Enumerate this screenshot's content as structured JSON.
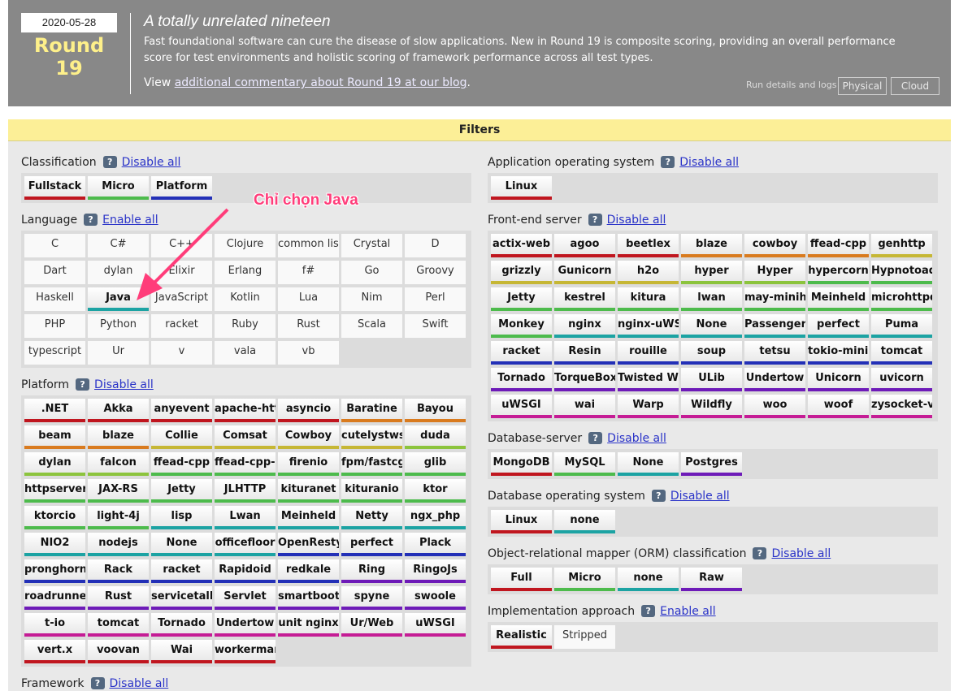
{
  "header": {
    "date": "2020-05-28",
    "round": "Round 19",
    "title": "A totally unrelated nineteen",
    "description": "Fast foundational software can cure the disease of slow applications. New in Round 19 is composite scoring, providing an overall performance score for test environments and holistic scoring of framework performance across all test types.",
    "view_prefix": "View ",
    "view_link": "additional commentary about Round 19 at our blog",
    "view_suffix": ".",
    "run_details": "Run details and logs",
    "physical": "Physical",
    "cloud": "Cloud"
  },
  "filters_title": "Filters",
  "help_glyph": "?",
  "annotation": "Chỉ chọn Java",
  "colors": {
    "red": "#c0161f",
    "green": "#4dbb4c",
    "blue": "#2330b7",
    "teal": "#1ca3a3",
    "orange": "#d97b1f",
    "yellow": "#c6b735",
    "lime": "#8cc43d",
    "purple": "#6e1bb8",
    "magenta": "#c51c95",
    "navy": "#1c3ea6",
    "arrow": "#ff3d7a"
  },
  "sections": [
    {
      "title": "Classification",
      "action": "Disable all",
      "cols": 3,
      "items": [
        [
          "Fullstack",
          "red",
          1
        ],
        [
          "Micro",
          "green",
          1
        ],
        [
          "Platform",
          "blue",
          1
        ]
      ]
    },
    {
      "title": "Language",
      "action": "Enable all",
      "cols": 7,
      "items": [
        [
          "C",
          "",
          0
        ],
        [
          "C#",
          "",
          0
        ],
        [
          "C++",
          "",
          0
        ],
        [
          "Clojure",
          "",
          0
        ],
        [
          "common lisp",
          "",
          0
        ],
        [
          "Crystal",
          "",
          0
        ],
        [
          "D",
          "",
          0
        ],
        [
          "Dart",
          "",
          0
        ],
        [
          "dylan",
          "",
          0
        ],
        [
          "Elixir",
          "",
          0
        ],
        [
          "Erlang",
          "",
          0
        ],
        [
          "f#",
          "",
          0
        ],
        [
          "Go",
          "",
          0
        ],
        [
          "Groovy",
          "",
          0
        ],
        [
          "Haskell",
          "",
          0
        ],
        [
          "Java",
          "teal",
          1
        ],
        [
          "JavaScript",
          "",
          0
        ],
        [
          "Kotlin",
          "",
          0
        ],
        [
          "Lua",
          "",
          0
        ],
        [
          "Nim",
          "",
          0
        ],
        [
          "Perl",
          "",
          0
        ],
        [
          "PHP",
          "",
          0
        ],
        [
          "Python",
          "",
          0
        ],
        [
          "racket",
          "",
          0
        ],
        [
          "Ruby",
          "",
          0
        ],
        [
          "Rust",
          "",
          0
        ],
        [
          "Scala",
          "",
          0
        ],
        [
          "Swift",
          "",
          0
        ],
        [
          "typescript",
          "",
          0
        ],
        [
          "Ur",
          "",
          0
        ],
        [
          "v",
          "",
          0
        ],
        [
          "vala",
          "",
          0
        ],
        [
          "vb",
          "",
          0
        ]
      ]
    },
    {
      "title": "Platform",
      "action": "Disable all",
      "cols": 7,
      "items": [
        [
          ".NET",
          "red",
          1
        ],
        [
          "Akka",
          "red",
          1
        ],
        [
          "anyevent",
          "red",
          1
        ],
        [
          "apache-http",
          "red",
          1
        ],
        [
          "asyncio",
          "red",
          1
        ],
        [
          "Baratine",
          "orange",
          1
        ],
        [
          "Bayou",
          "orange",
          1
        ],
        [
          "beam",
          "orange",
          1
        ],
        [
          "blaze",
          "orange",
          1
        ],
        [
          "Collie",
          "yellow",
          1
        ],
        [
          "Comsat",
          "yellow",
          1
        ],
        [
          "Cowboy",
          "yellow",
          1
        ],
        [
          "cutelystwsgi",
          "yellow",
          1
        ],
        [
          "duda",
          "lime",
          1
        ],
        [
          "dylan",
          "lime",
          1
        ],
        [
          "falcon",
          "lime",
          1
        ],
        [
          "ffead-cpp",
          "green",
          1
        ],
        [
          "ffead-cpp-ng",
          "green",
          1
        ],
        [
          "firenio",
          "green",
          1
        ],
        [
          "fpm/fastcgi",
          "green",
          1
        ],
        [
          "glib",
          "green",
          1
        ],
        [
          "httpserver",
          "green",
          1
        ],
        [
          "JAX-RS",
          "green",
          1
        ],
        [
          "Jetty",
          "green",
          1
        ],
        [
          "JLHTTP",
          "green",
          1
        ],
        [
          "kituranet",
          "green",
          1
        ],
        [
          "kituranio",
          "green",
          1
        ],
        [
          "ktor",
          "green",
          1
        ],
        [
          "ktorcio",
          "green",
          1
        ],
        [
          "light-4j",
          "green",
          1
        ],
        [
          "lisp",
          "teal",
          1
        ],
        [
          "Lwan",
          "teal",
          1
        ],
        [
          "Meinheld",
          "teal",
          1
        ],
        [
          "Netty",
          "teal",
          1
        ],
        [
          "ngx_php",
          "teal",
          1
        ],
        [
          "NIO2",
          "teal",
          1
        ],
        [
          "nodejs",
          "teal",
          1
        ],
        [
          "None",
          "teal",
          1
        ],
        [
          "officefloor",
          "teal",
          1
        ],
        [
          "OpenResty",
          "blue",
          1
        ],
        [
          "perfect",
          "blue",
          1
        ],
        [
          "Plack",
          "blue",
          1
        ],
        [
          "pronghorn",
          "blue",
          1
        ],
        [
          "Rack",
          "blue",
          1
        ],
        [
          "racket",
          "blue",
          1
        ],
        [
          "Rapidoid",
          "blue",
          1
        ],
        [
          "redkale",
          "blue",
          1
        ],
        [
          "Ring",
          "purple",
          1
        ],
        [
          "RingoJs",
          "purple",
          1
        ],
        [
          "roadrunner",
          "purple",
          1
        ],
        [
          "Rust",
          "purple",
          1
        ],
        [
          "servicetalk",
          "purple",
          1
        ],
        [
          "Servlet",
          "purple",
          1
        ],
        [
          "smartboot",
          "purple",
          1
        ],
        [
          "spyne",
          "purple",
          1
        ],
        [
          "swoole",
          "purple",
          1
        ],
        [
          "t-io",
          "magenta",
          1
        ],
        [
          "tomcat",
          "magenta",
          1
        ],
        [
          "Tornado",
          "magenta",
          1
        ],
        [
          "Undertow",
          "magenta",
          1
        ],
        [
          "unit nginx",
          "magenta",
          1
        ],
        [
          "Ur/Web",
          "magenta",
          1
        ],
        [
          "uWSGI",
          "magenta",
          1
        ],
        [
          "vert.x",
          "red",
          1
        ],
        [
          "voovan",
          "red",
          1
        ],
        [
          "Wai",
          "red",
          1
        ],
        [
          "workerman",
          "red",
          1
        ]
      ]
    },
    {
      "title": "Framework",
      "action": "Disable all",
      "cols": 7,
      "items": []
    },
    {
      "title": "Application operating system",
      "action": "Disable all",
      "cols": 1,
      "items": [
        [
          "Linux",
          "red",
          1
        ]
      ]
    },
    {
      "title": "Front-end server",
      "action": "Disable all",
      "cols": 7,
      "items": [
        [
          "actix-web",
          "red",
          1
        ],
        [
          "agoo",
          "red",
          1
        ],
        [
          "beetlex",
          "red",
          1
        ],
        [
          "blaze",
          "orange",
          1
        ],
        [
          "cowboy",
          "orange",
          1
        ],
        [
          "ffead-cpp",
          "orange",
          1
        ],
        [
          "genhttp",
          "yellow",
          1
        ],
        [
          "grizzly",
          "yellow",
          1
        ],
        [
          "Gunicorn",
          "yellow",
          1
        ],
        [
          "h2o",
          "yellow",
          1
        ],
        [
          "hyper",
          "lime",
          1
        ],
        [
          "Hyper",
          "lime",
          1
        ],
        [
          "hypercorn",
          "green",
          1
        ],
        [
          "Hypnotoad",
          "green",
          1
        ],
        [
          "Jetty",
          "green",
          1
        ],
        [
          "kestrel",
          "green",
          1
        ],
        [
          "kitura",
          "green",
          1
        ],
        [
          "lwan",
          "green",
          1
        ],
        [
          "may-minihttp",
          "green",
          1
        ],
        [
          "Meinheld",
          "green",
          1
        ],
        [
          "microhttpd",
          "green",
          1
        ],
        [
          "Monkey",
          "green",
          1
        ],
        [
          "nginx",
          "teal",
          1
        ],
        [
          "nginx-uWSGI",
          "teal",
          1
        ],
        [
          "None",
          "teal",
          1
        ],
        [
          "Passenger",
          "teal",
          1
        ],
        [
          "perfect",
          "teal",
          1
        ],
        [
          "Puma",
          "teal",
          1
        ],
        [
          "racket",
          "blue",
          1
        ],
        [
          "Resin",
          "blue",
          1
        ],
        [
          "rouille",
          "blue",
          1
        ],
        [
          "soup",
          "blue",
          1
        ],
        [
          "tetsu",
          "blue",
          1
        ],
        [
          "tokio-minihttp",
          "blue",
          1
        ],
        [
          "tomcat",
          "blue",
          1
        ],
        [
          "Tornado",
          "purple",
          1
        ],
        [
          "TorqueBox",
          "purple",
          1
        ],
        [
          "Twisted Web",
          "purple",
          1
        ],
        [
          "ULib",
          "purple",
          1
        ],
        [
          "Undertow",
          "purple",
          1
        ],
        [
          "Unicorn",
          "purple",
          1
        ],
        [
          "uvicorn",
          "purple",
          1
        ],
        [
          "uWSGI",
          "magenta",
          1
        ],
        [
          "wai",
          "magenta",
          1
        ],
        [
          "Warp",
          "magenta",
          1
        ],
        [
          "Wildfly",
          "magenta",
          1
        ],
        [
          "woo",
          "magenta",
          1
        ],
        [
          "woof",
          "magenta",
          1
        ],
        [
          "zysocket-v",
          "magenta",
          1
        ]
      ]
    },
    {
      "title": "Database-server",
      "action": "Disable all",
      "cols": 4,
      "items": [
        [
          "MongoDB",
          "red",
          1
        ],
        [
          "MySQL",
          "green",
          1
        ],
        [
          "None",
          "teal",
          1
        ],
        [
          "Postgres",
          "purple",
          1
        ]
      ]
    },
    {
      "title": "Database operating system",
      "action": "Disable all",
      "cols": 2,
      "items": [
        [
          "Linux",
          "red",
          1
        ],
        [
          "none",
          "teal",
          1
        ]
      ]
    },
    {
      "title": "Object-relational mapper (ORM) classification",
      "action": "Disable all",
      "cols": 4,
      "items": [
        [
          "Full",
          "red",
          1
        ],
        [
          "Micro",
          "green",
          1
        ],
        [
          "none",
          "teal",
          1
        ],
        [
          "Raw",
          "purple",
          1
        ]
      ]
    },
    {
      "title": "Implementation approach",
      "action": "Enable all",
      "cols": 2,
      "items": [
        [
          "Realistic",
          "red",
          1
        ],
        [
          "Stripped",
          "",
          0
        ]
      ]
    }
  ]
}
